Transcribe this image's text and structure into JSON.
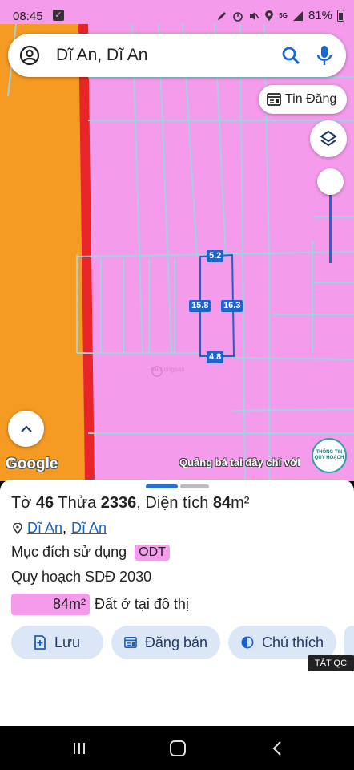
{
  "status_bar": {
    "time": "08:45",
    "battery": "81%",
    "network": "5G"
  },
  "search": {
    "text": "Dĩ An, Dĩ An"
  },
  "map": {
    "tin_dang_label": "Tin Đăng",
    "dimensions": {
      "top": "5.2",
      "left": "15.8",
      "right": "16.3",
      "bottom": "4.8"
    },
    "watermark": "Batdongsan",
    "google_label": "Google",
    "ad_text": "Quảng bá tại đây chỉ với",
    "qh_badge": [
      "THÔNG TIN",
      "QUY HOẠCH"
    ],
    "colors": {
      "residential": "#f49bec",
      "orange_zone": "#f59a22",
      "road_red": "#e8262a",
      "parcel_outline": "#1d63c8",
      "boundary": "#9fd3e2"
    }
  },
  "sheet": {
    "title": {
      "to_label": "Tờ",
      "to_value": "46",
      "thua_label": "Thửa",
      "thua_value": "2336",
      "dientich_label": ", Diện tích",
      "area_value": "84",
      "area_unit": "m²"
    },
    "location": {
      "ward": "Dĩ An",
      "separator": ",",
      "city": "Dĩ An"
    },
    "purpose_label": "Mục đích sử dụng",
    "purpose_code": "ODT",
    "plan_label": "Quy hoạch SDĐ 2030",
    "area_swatch": "84m²",
    "area_desc": "Đất ở tại đô thị",
    "actions": {
      "save": "Lưu",
      "sell": "Đăng bán",
      "legend": "Chú thích"
    },
    "ad_off": "TẮT QC"
  }
}
